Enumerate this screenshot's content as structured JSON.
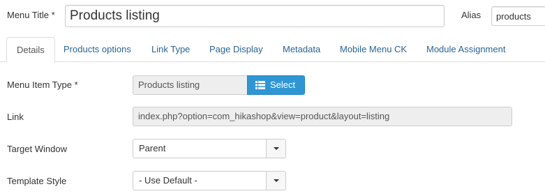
{
  "form": {
    "menu_title_label": "Menu Title *",
    "menu_title_value": "Products listing",
    "alias_label": "Alias",
    "alias_value": "products"
  },
  "tabs": [
    {
      "label": "Details",
      "active": true
    },
    {
      "label": "Products options"
    },
    {
      "label": "Link Type"
    },
    {
      "label": "Page Display"
    },
    {
      "label": "Metadata"
    },
    {
      "label": "Mobile Menu CK"
    },
    {
      "label": "Module Assignment"
    }
  ],
  "details": {
    "menu_item_type_label": "Menu Item Type *",
    "menu_item_type_value": "Products listing",
    "select_button_label": "Select",
    "select_icon": "list-icon",
    "link_label": "Link",
    "link_value": "index.php?option=com_hikashop&view=product&layout=listing",
    "target_window_label": "Target Window",
    "target_window_value": "Parent",
    "template_style_label": "Template Style",
    "template_style_value": "- Use Default -"
  },
  "colors": {
    "accent": "#2f96d4",
    "tab_link": "#2a6496",
    "readonly_bg": "#eeeeee"
  }
}
